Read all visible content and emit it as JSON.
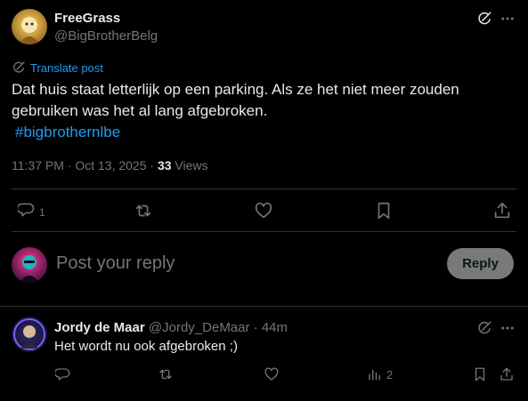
{
  "post": {
    "display_name": "FreeGrass",
    "handle": "@BigBrotherBelg",
    "translate_label": "Translate post",
    "text": "Dat huis staat letterlijk op een parking. Als ze het niet meer zouden gebruiken was het al lang afgebroken.",
    "hashtag": "#bigbrothernlbe",
    "timestamp": "11:37 PM · Oct 13, 2025 · ",
    "views_count": "33",
    "views_label": "Views",
    "reply_count": "1",
    "icons": [
      "grok-icon",
      "more-icon",
      "translate-icon",
      "reply-icon",
      "repost-icon",
      "like-icon",
      "bookmark-icon",
      "share-icon"
    ]
  },
  "composer": {
    "placeholder": "Post your reply",
    "button_label": "Reply"
  },
  "reply": {
    "display_name": "Jordy de Maar",
    "handle": "@Jordy_DeMaar",
    "separator": "·",
    "time": "44m",
    "text": "Het wordt nu ook afgebroken ;)",
    "views_count": "2"
  },
  "colors": {
    "background": "#000000",
    "text": "#e7e9ea",
    "muted": "#71767b",
    "accent": "#1d9bf0",
    "divider": "#2f3336"
  }
}
